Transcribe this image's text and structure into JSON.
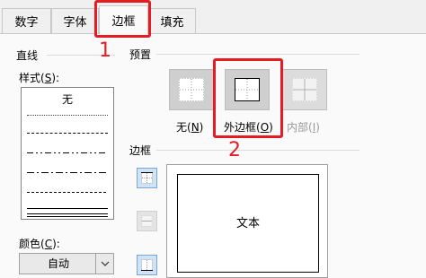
{
  "tabs": [
    {
      "label": "数字",
      "active": false
    },
    {
      "label": "字体",
      "active": false
    },
    {
      "label": "边框",
      "active": true
    },
    {
      "label": "填充",
      "active": false
    }
  ],
  "line": {
    "group_label": "直线",
    "style_label": "样式(S):",
    "style_accel": "S",
    "none_option": "无",
    "color_label": "颜色(C):",
    "color_accel": "C",
    "color_value": "自动"
  },
  "presets": {
    "group_label": "预置",
    "items": [
      {
        "label": "无(N)",
        "pre": "无(",
        "accel": "N",
        "post": ")",
        "enabled": true
      },
      {
        "label": "外边框(O)",
        "pre": "外边框(",
        "accel": "O",
        "post": ")",
        "enabled": true
      },
      {
        "label": "内部(I)",
        "pre": "内部(",
        "accel": "I",
        "post": ")",
        "enabled": false
      }
    ]
  },
  "border": {
    "group_label": "边框",
    "preview_text": "文本"
  },
  "annotations": {
    "step1": "1",
    "step2": "2",
    "color": "#e51c23"
  }
}
